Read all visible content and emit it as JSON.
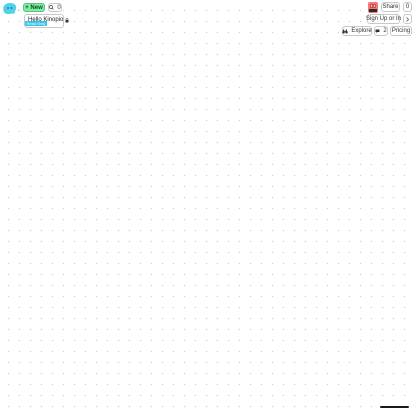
{
  "header": {
    "new_label": "+ New",
    "search_icon": "search-icon",
    "search_shortcut": "0"
  },
  "space": {
    "name": "Hello Kinopio",
    "lock_icon": "lock-icon",
    "badge": "Read Only"
  },
  "right_controls": {
    "share_label": "Share",
    "menu_label": "0",
    "signup_label": "Sign Up or In",
    "chevron_icon": "chevron-right-icon",
    "explore_label": "Explore",
    "comments_count": "2",
    "pricing_label": "Pricing"
  },
  "colors": {
    "new_button": "#7ef0a3",
    "badge": "#33c3e8",
    "logo": "#4fd2e6"
  }
}
